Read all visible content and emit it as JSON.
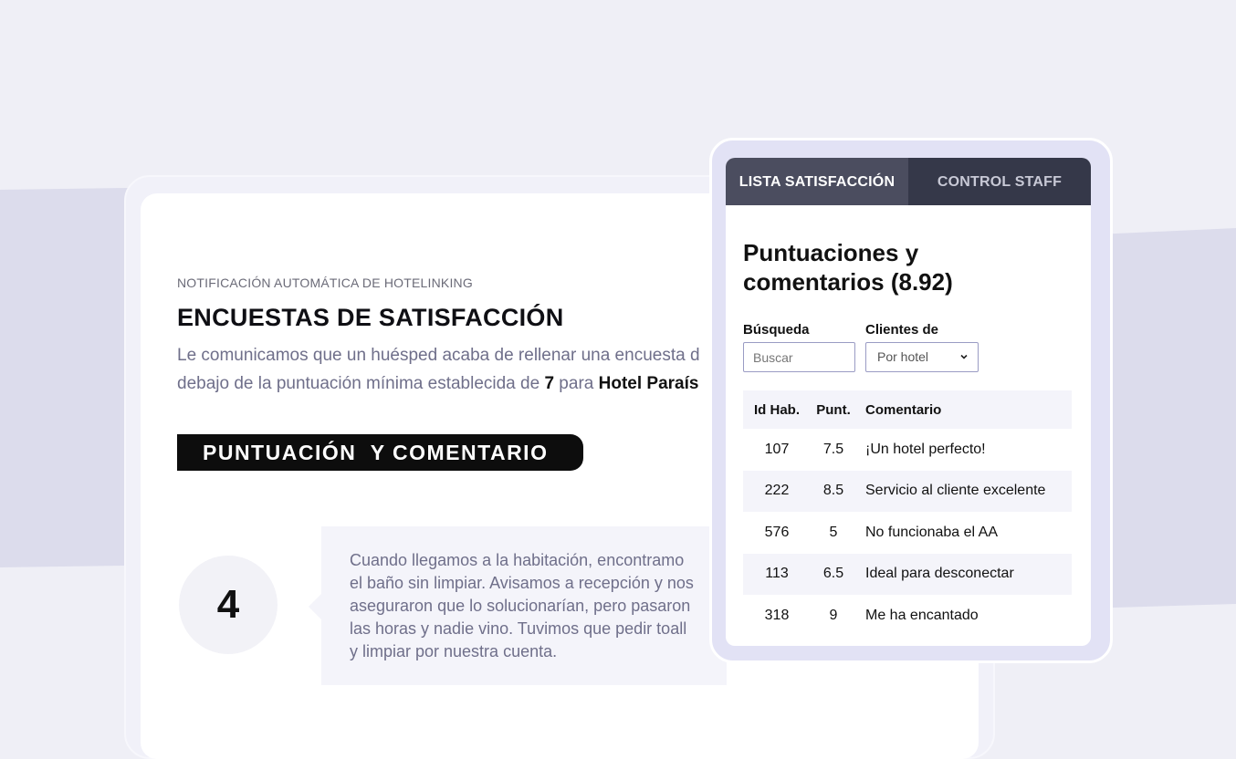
{
  "email": {
    "eyebrow": "NOTIFICACIÓN AUTOMÁTICA DE HOTELINKING",
    "headline": "ENCUESTAS DE SATISFACCIÓN",
    "intro_part1": "Le comunicamos que un huésped acaba de rellenar una encuesta d",
    "intro_part2": "debajo de la puntuación mínima establecida de ",
    "min_score": "7",
    "intro_part3": " para ",
    "hotel_name": "Hotel Paraís",
    "section_title": "PUNTUACIÓN  Y COMENTARIO",
    "score": "4",
    "comment": "Cuando llegamos a la habitación, encontramo\nel baño sin limpiar. Avisamos a recepción y nos\naseguraron que lo solucionarían, pero pasaron\nlas horas y nadie vino. Tuvimos que pedir toall\ny limpiar por nuestra cuenta."
  },
  "panel": {
    "tabs": [
      {
        "label": "LISTA SATISFACCIÓN",
        "active": true
      },
      {
        "label": "CONTROL STAFF",
        "active": false
      }
    ],
    "title": "Puntuaciones y comentarios (8.92)",
    "search": {
      "label": "Búsqueda",
      "placeholder": "Buscar"
    },
    "filter": {
      "label": "Clientes de",
      "selected": "Por hotel"
    },
    "table": {
      "headers": [
        "Id Hab.",
        "Punt.",
        "Comentario"
      ],
      "rows": [
        {
          "room": "107",
          "score": "7.5",
          "comment": "¡Un hotel perfecto!"
        },
        {
          "room": "222",
          "score": "8.5",
          "comment": "Servicio al cliente excelente"
        },
        {
          "room": "576",
          "score": "5",
          "comment": "No funcionaba el AA"
        },
        {
          "room": "113",
          "score": "6.5",
          "comment": "Ideal para desconectar"
        },
        {
          "room": "318",
          "score": "9",
          "comment": "Me ha encantado"
        }
      ]
    }
  },
  "colors": {
    "background": "#efeff6",
    "tab_active": "#4b4d5f",
    "tab_inactive": "#353849",
    "panel_frame": "#e2e2f5",
    "muted_text": "#6f6f8a"
  }
}
